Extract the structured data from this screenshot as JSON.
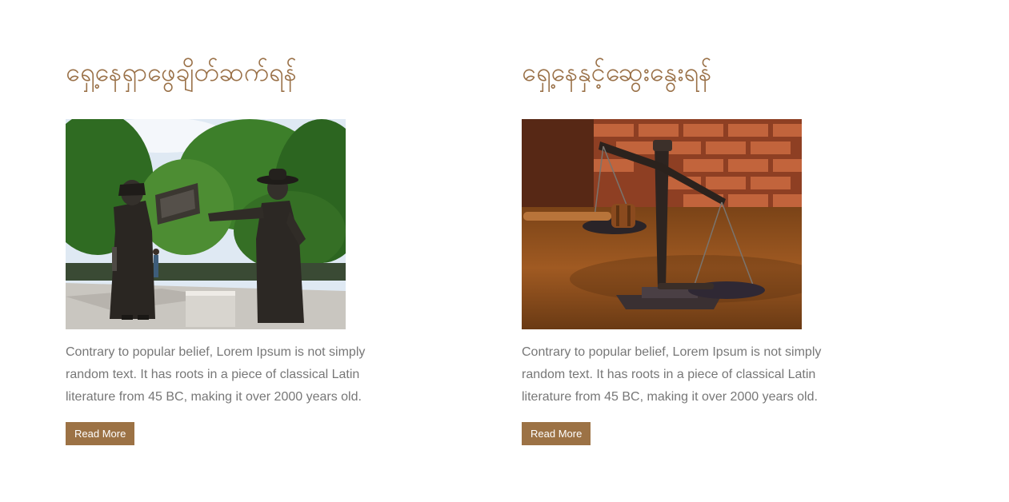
{
  "cards": [
    {
      "title": "ရှေ့နေရှာဖွေချိတ်ဆက်ရန်",
      "image": "statue-photo",
      "description": "Contrary to popular belief, Lorem Ipsum is not simply random text. It has roots in a piece of classical Latin literature from 45 BC, making it over 2000 years old.",
      "button_label": "Read More"
    },
    {
      "title": "ရှေ့နေနှင့်ဆွေးနွေးရန်",
      "image": "scales-of-justice-photo",
      "description": "Contrary to popular belief, Lorem Ipsum is not simply random text. It has roots in a piece of classical Latin literature from 45 BC, making it over 2000 years old.",
      "button_label": "Read More"
    }
  ],
  "colors": {
    "accent": "#9c7245",
    "title": "#9a7148",
    "text": "#777777"
  }
}
